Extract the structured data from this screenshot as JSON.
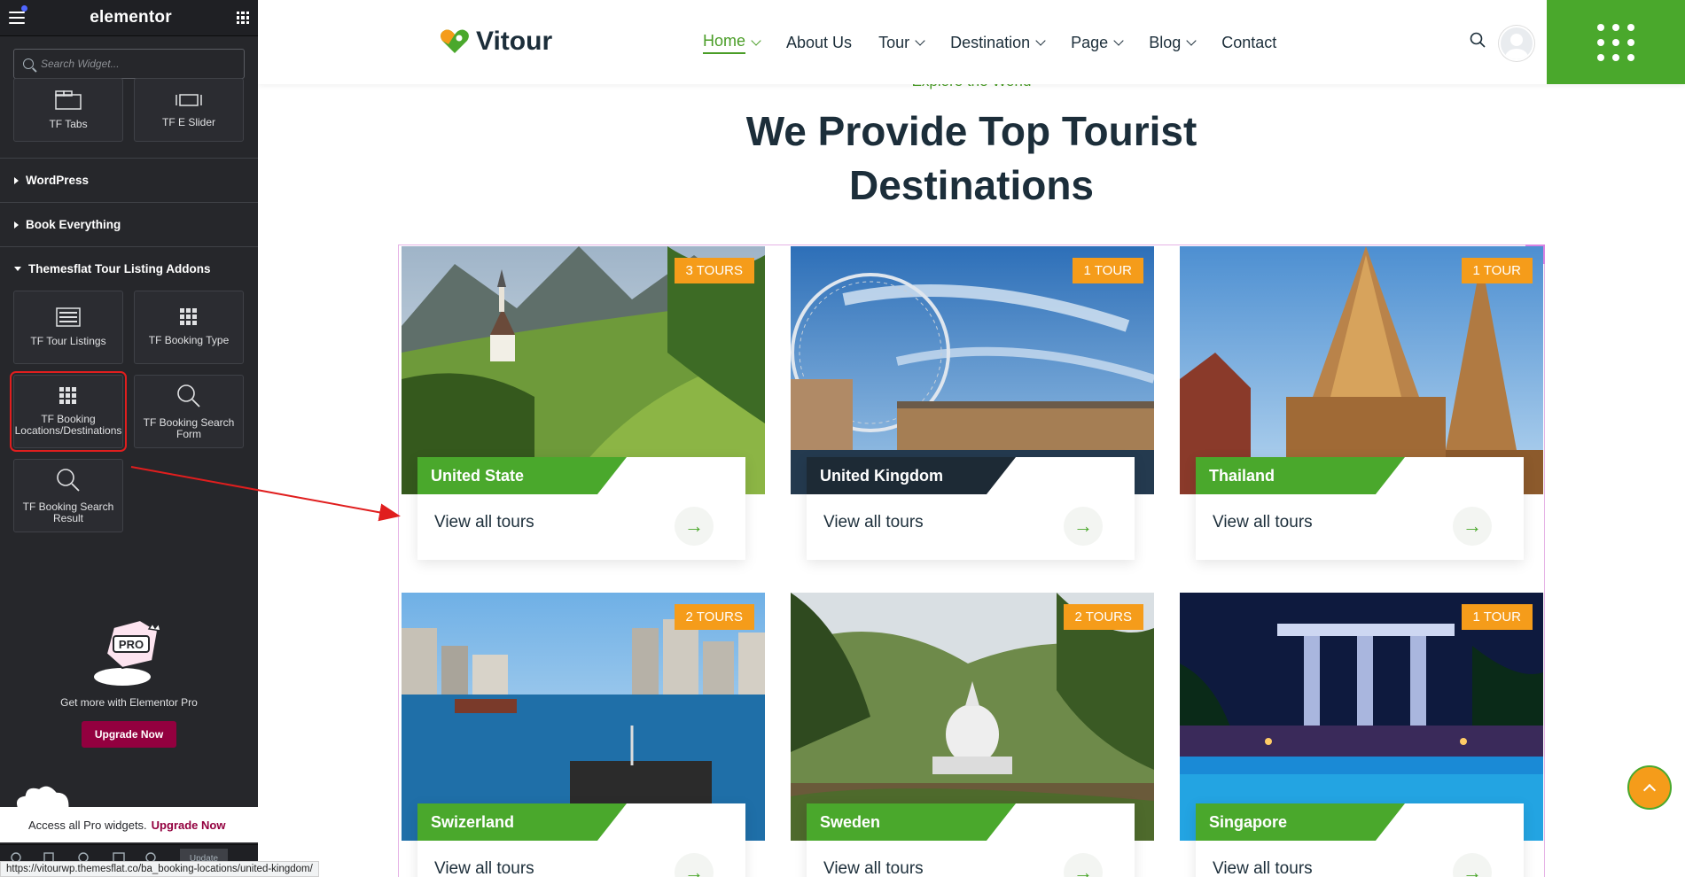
{
  "panel": {
    "logo": "elementor",
    "search_placeholder": "Search Widget...",
    "top_widgets": [
      "TF Tabs",
      "TF E Slider"
    ],
    "categories": [
      "WordPress",
      "Book Everything",
      "Themesflat Tour Listing Addons"
    ],
    "addon_widgets": [
      "TF Tour Listings",
      "TF Booking Type",
      "TF Booking Locations/Destinations",
      "TF Booking Search Form",
      "TF Booking Search Result"
    ],
    "promo_text": "Get more with Elementor Pro",
    "upgrade_button": "Upgrade Now",
    "pro_strip_text": "Access all Pro widgets.",
    "pro_strip_link": "Upgrade Now",
    "bottom_update": "Update"
  },
  "site": {
    "brand": "Vitour",
    "nav": [
      "Home",
      "About Us",
      "Tour",
      "Destination",
      "Page",
      "Blog",
      "Contact"
    ],
    "subtitle": "Explore the World",
    "title_line1": "We Provide Top Tourist",
    "title_line2": "Destinations",
    "view_all": "View all tours",
    "destinations": [
      {
        "name": "United State",
        "badge": "3 TOURS"
      },
      {
        "name": "United Kingdom",
        "badge": "1 TOUR"
      },
      {
        "name": "Thailand",
        "badge": "1 TOUR"
      },
      {
        "name": "Swizerland",
        "badge": "2 TOURS"
      },
      {
        "name": "Sweden",
        "badge": "2 TOURS"
      },
      {
        "name": "Singapore",
        "badge": "1 TOUR"
      }
    ]
  },
  "status_url": "https://vitourwp.themesflat.co/ba_booking-locations/united-kingdom/",
  "colors": {
    "accent_green": "#4aa82c",
    "badge_orange": "#f59c1a",
    "elementor_dark": "#26272b",
    "pro_magenta": "#93003f"
  }
}
